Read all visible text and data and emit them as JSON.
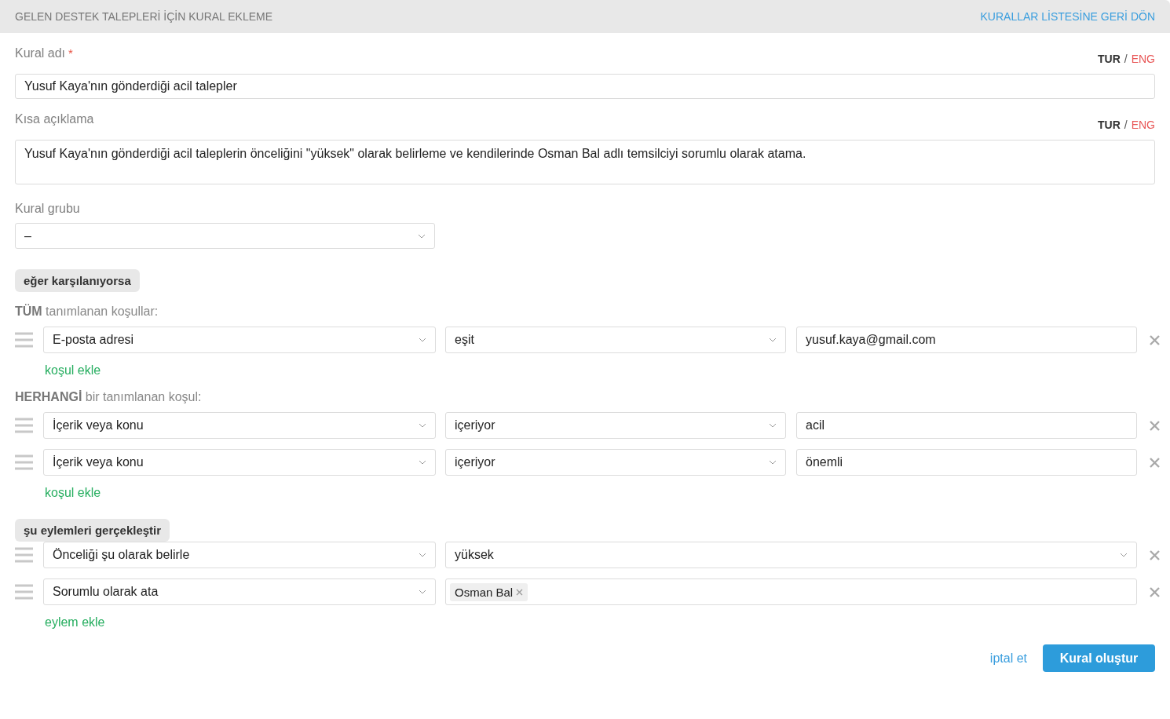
{
  "header": {
    "title": "GELEN DESTEK TALEPLERİ İÇİN KURAL EKLEME",
    "back_link": "KURALLAR LİSTESİNE GERİ DÖN"
  },
  "rule_name": {
    "label": "Kural adı",
    "required_mark": "*",
    "languages": [
      {
        "label": "TUR",
        "selected": true
      },
      {
        "label": "ENG",
        "selected": false
      }
    ],
    "separator": "/",
    "value": "Yusuf Kaya'nın gönderdiği acil talepler"
  },
  "description": {
    "label": "Kısa açıklama",
    "languages": [
      {
        "label": "TUR",
        "selected": true
      },
      {
        "label": "ENG",
        "selected": false
      }
    ],
    "separator": "/",
    "value": "Yusuf Kaya'nın gönderdiği acil taleplerin önceliğini \"yüksek\" olarak belirleme ve kendilerinde Osman Bal adlı temsilciyi sorumlu olarak atama."
  },
  "rule_group": {
    "label": "Kural grubu",
    "value": "–"
  },
  "conditions_section": {
    "badge": "eğer karşılanıyorsa"
  },
  "condition_groups": [
    {
      "heading": "**TÜM** tanımlanan koşullar:",
      "rows": [
        {
          "field": "E-posta adresi",
          "operator": "eşit",
          "value": "yusuf.kaya@gmail.com"
        }
      ],
      "add_link": "koşul ekle"
    },
    {
      "heading": "**HERHANGİ** bir tanımlanan koşul:",
      "rows": [
        {
          "field": "İçerik veya konu",
          "operator": "içeriyor",
          "value": "acil"
        },
        {
          "field": "İçerik veya konu",
          "operator": "içeriyor",
          "value": "önemli"
        }
      ],
      "add_link": "koşul ekle"
    }
  ],
  "actions_section": {
    "badge": "şu eylemleri gerçekleştir",
    "add_link": "eylem ekle"
  },
  "actions": [
    {
      "kind": "select",
      "action": "Önceliği şu olarak belirle",
      "value": "yüksek"
    },
    {
      "kind": "tags",
      "action": "Sorumlu olarak ata",
      "tags": [
        "Osman Bal"
      ]
    }
  ],
  "footer": {
    "cancel": "iptal et",
    "submit": "Kural oluştur"
  }
}
